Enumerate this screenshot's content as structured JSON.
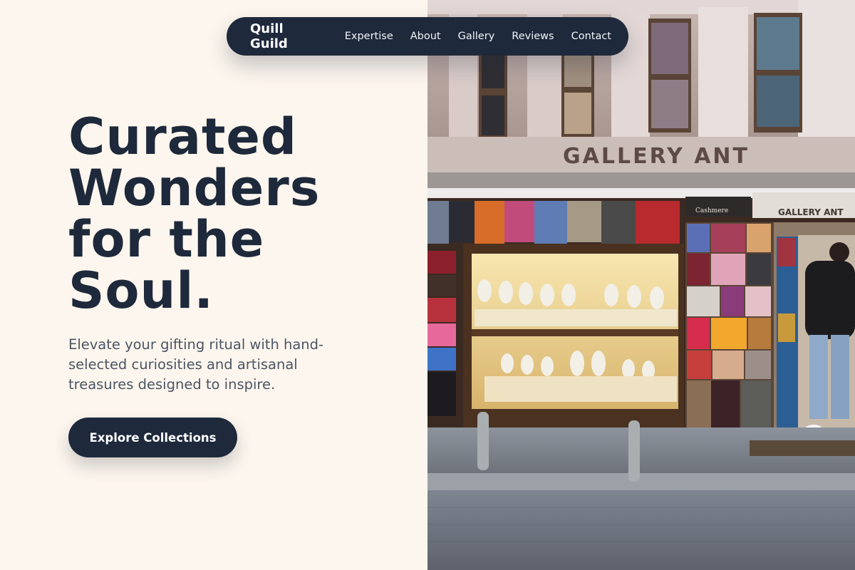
{
  "nav": {
    "brand": "Quill Guild",
    "links": [
      "Expertise",
      "About",
      "Gallery",
      "Reviews",
      "Contact"
    ]
  },
  "hero": {
    "title_lines": [
      "Curated",
      "Wonders",
      "for the",
      "Soul."
    ],
    "subtitle": "Elevate your gifting ritual with hand-selected curiosities and artisanal treasures designed to inspire.",
    "cta_label": "Explore Collections"
  },
  "photo": {
    "sign_main": "GALLERY ANT",
    "sign_small": "GALLERY ANT",
    "sign_board": "Cashmere"
  },
  "colors": {
    "background": "#fdf6ee",
    "navy": "#1e293b",
    "text_muted": "#4b5563"
  }
}
